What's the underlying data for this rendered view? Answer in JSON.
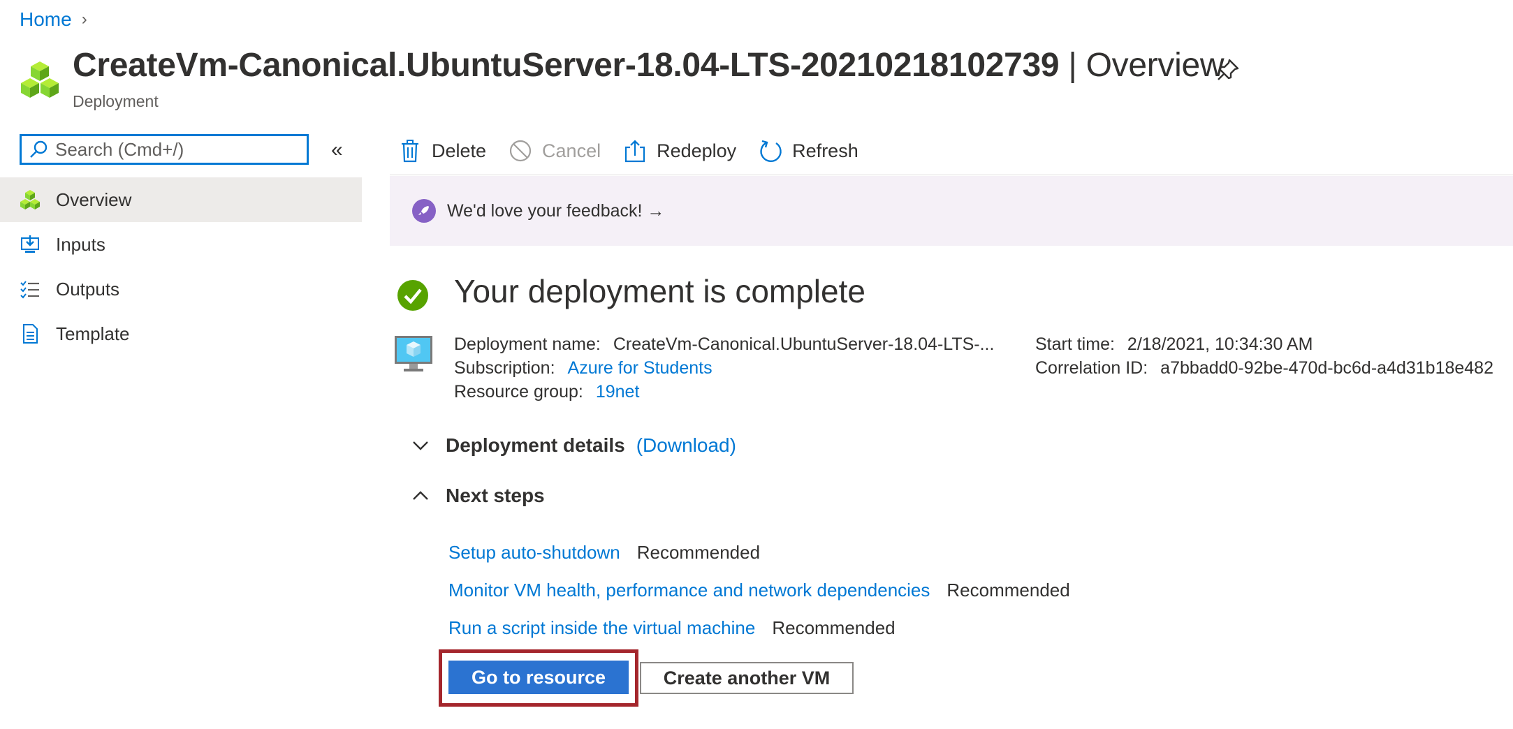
{
  "breadcrumb": {
    "home": "Home",
    "separator": "›"
  },
  "header": {
    "title": "CreateVm-Canonical.UbuntuServer-18.04-LTS-20210218102739",
    "title_separator": "|",
    "title_suffix": "Overview",
    "subtitle": "Deployment",
    "icon": "deployment-cubes-icon",
    "pin_icon": "pin-icon"
  },
  "sidebar": {
    "search_placeholder": "Search (Cmd+/)",
    "collapse_glyph": "«",
    "items": [
      {
        "label": "Overview",
        "icon": "overview-cubes-icon",
        "active": true
      },
      {
        "label": "Inputs",
        "icon": "inputs-icon",
        "active": false
      },
      {
        "label": "Outputs",
        "icon": "outputs-icon",
        "active": false
      },
      {
        "label": "Template",
        "icon": "template-icon",
        "active": false
      }
    ]
  },
  "toolbar": {
    "delete": "Delete",
    "cancel": "Cancel",
    "redeploy": "Redeploy",
    "refresh": "Refresh"
  },
  "banner": {
    "text": "We'd love your feedback! →"
  },
  "status": {
    "heading": "Your deployment is complete",
    "deployment_name_label": "Deployment name:",
    "deployment_name_value": "CreateVm-Canonical.UbuntuServer-18.04-LTS-...",
    "subscription_label": "Subscription:",
    "subscription_value": "Azure for Students",
    "resource_group_label": "Resource group:",
    "resource_group_value": "19net",
    "start_time_label": "Start time:",
    "start_time_value": "2/18/2021, 10:34:30 AM",
    "correlation_label": "Correlation ID:",
    "correlation_value": "a7bbadd0-92be-470d-bc6d-a4d31b18e482"
  },
  "details": {
    "label": "Deployment details",
    "download": "(Download)"
  },
  "next_steps": {
    "label": "Next steps",
    "items": [
      {
        "link": "Setup auto-shutdown",
        "tag": "Recommended"
      },
      {
        "link": "Monitor VM health, performance and network dependencies",
        "tag": "Recommended"
      },
      {
        "link": "Run a script inside the virtual machine",
        "tag": "Recommended"
      }
    ]
  },
  "buttons": {
    "go_to_resource": "Go to resource",
    "create_another": "Create another VM"
  },
  "colors": {
    "accent": "#0078d4",
    "success": "#57a300",
    "highlight_frame": "#a4262c",
    "banner_bg": "#f5f0f7"
  }
}
